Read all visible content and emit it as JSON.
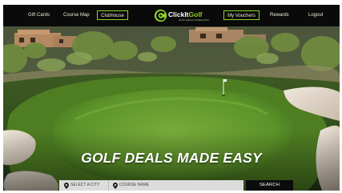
{
  "nav": {
    "gift_cards": "Gift Cards",
    "course_map": "Course Map",
    "clubhouse": "Clubhouse",
    "my_vouchers": "My Vouchers",
    "rewards": "Rewards",
    "logout": "Logout"
  },
  "logo": {
    "word_primary": "ClickIt",
    "word_accent": "Golf",
    "tagline": "GOLF DEALS MADE EASY",
    "icon": "golf-ball-c-logo-icon"
  },
  "hero": {
    "headline": "GOLF DEALS MADE EASY"
  },
  "search": {
    "city_placeholder": "SELECT A CITY",
    "course_placeholder": "COURSE NAME",
    "button_label": "SEARCH",
    "pin_icon": "map-pin-icon"
  },
  "colors": {
    "accent": "#8fd32a",
    "nav_bg": "#0a0a0a",
    "search_button": "#0c0c0c",
    "field_bg": "#dcdcdc"
  }
}
